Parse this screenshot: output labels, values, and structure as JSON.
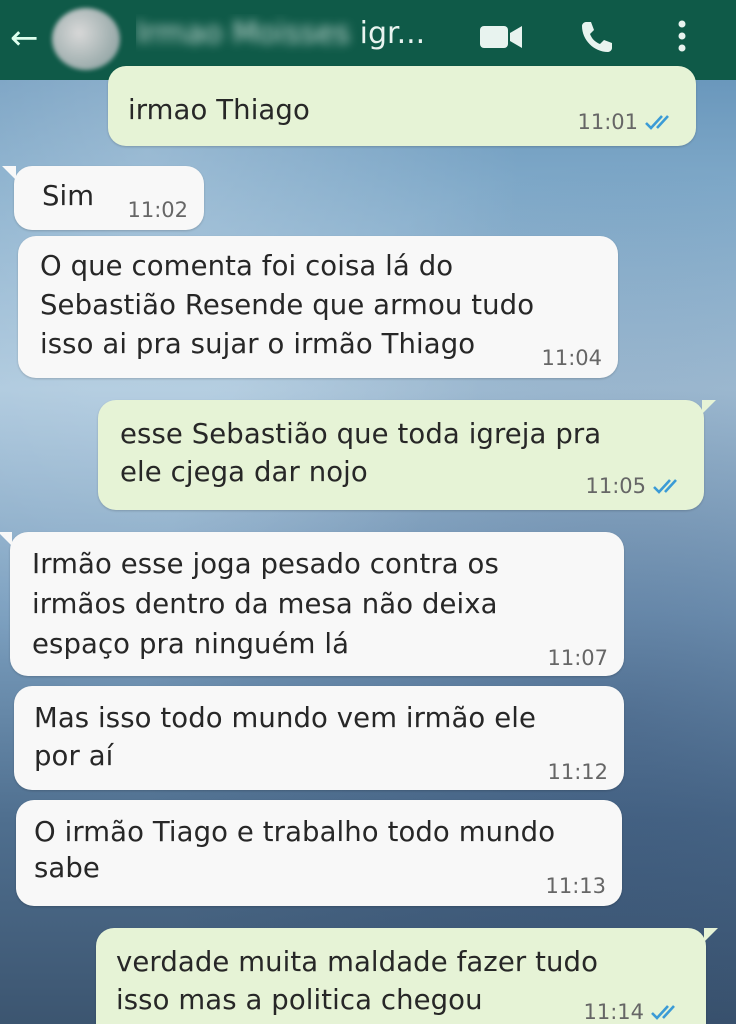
{
  "header": {
    "contact_name_blurred": "Irmao Moisses",
    "contact_name_suffix": "igr...",
    "colors": {
      "bar": "#0f5a48",
      "icons": "#e8f3ef"
    }
  },
  "messages": [
    {
      "direction": "out",
      "text_lines": [
        "irmao Thiago"
      ],
      "time": "11:01",
      "read": true
    },
    {
      "direction": "in",
      "text_lines": [
        "Sim"
      ],
      "time": "11:02"
    },
    {
      "direction": "in",
      "text_lines": [
        "O que comenta foi coisa lá do",
        "Sebastião Resende  que armou tudo",
        "isso ai pra sujar o irmão Thiago"
      ],
      "time": "11:04"
    },
    {
      "direction": "out",
      "text_lines": [
        "esse Sebastião que toda igreja pra",
        "ele cjega dar nojo"
      ],
      "time": "11:05",
      "read": true
    },
    {
      "direction": "in",
      "text_lines": [
        "Irmão esse joga pesado contra os",
        "irmãos dentro da mesa não deixa",
        "espaço pra ninguém lá"
      ],
      "time": "11:07"
    },
    {
      "direction": "in",
      "text_lines": [
        "Mas isso todo mundo vem irmão  ele",
        "por aí"
      ],
      "time": "11:12"
    },
    {
      "direction": "in",
      "text_lines": [
        "O irmão Tiago e trabalho todo mundo",
        "sabe"
      ],
      "time": "11:13"
    },
    {
      "direction": "out",
      "text_lines": [
        "verdade muita maldade fazer tudo",
        "isso mas a politica chegou"
      ],
      "time": "11:14",
      "read": true
    }
  ],
  "colors": {
    "incoming_bubble": "#f8f8f8",
    "outgoing_bubble": "#e6f3d6",
    "read_ticks": "#3b9bd6"
  }
}
